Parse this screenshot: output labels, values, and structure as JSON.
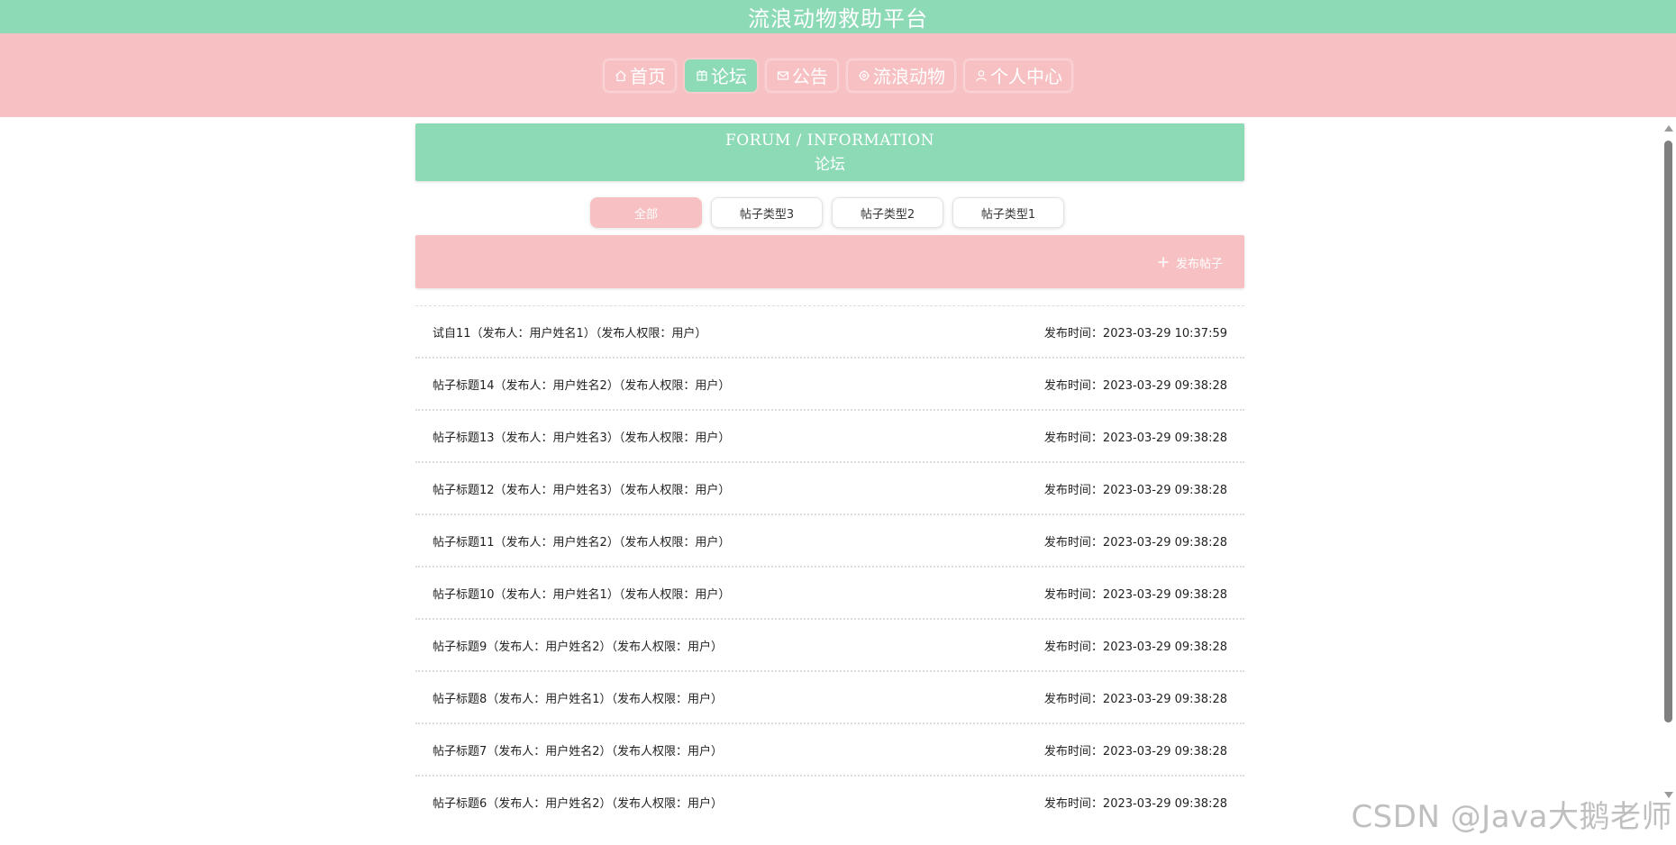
{
  "app": {
    "title": "流浪动物救助平台"
  },
  "nav": {
    "items": [
      {
        "label": "首页",
        "icon": "home-icon",
        "active": false
      },
      {
        "label": "论坛",
        "icon": "forum-icon",
        "active": true
      },
      {
        "label": "公告",
        "icon": "mail-icon",
        "active": false
      },
      {
        "label": "流浪动物",
        "icon": "paw-icon",
        "active": false
      },
      {
        "label": "个人中心",
        "icon": "user-icon",
        "active": false
      }
    ]
  },
  "banner": {
    "english": "FORUM / INFORMATION",
    "chinese": "论坛"
  },
  "tabs": [
    {
      "label": "全部",
      "active": true
    },
    {
      "label": "帖子类型3",
      "active": false
    },
    {
      "label": "帖子类型2",
      "active": false
    },
    {
      "label": "帖子类型1",
      "active": false
    }
  ],
  "actions": {
    "publish_label": "发布帖子"
  },
  "posts": [
    {
      "summary": "试自11（发布人：用户姓名1）（发布人权限：用户）",
      "time": "发布时间：2023-03-29 10:37:59"
    },
    {
      "summary": "帖子标题14（发布人：用户姓名2）（发布人权限：用户）",
      "time": "发布时间：2023-03-29 09:38:28"
    },
    {
      "summary": "帖子标题13（发布人：用户姓名3）（发布人权限：用户）",
      "time": "发布时间：2023-03-29 09:38:28"
    },
    {
      "summary": "帖子标题12（发布人：用户姓名3）（发布人权限：用户）",
      "time": "发布时间：2023-03-29 09:38:28"
    },
    {
      "summary": "帖子标题11（发布人：用户姓名2）（发布人权限：用户）",
      "time": "发布时间：2023-03-29 09:38:28"
    },
    {
      "summary": "帖子标题10（发布人：用户姓名1）（发布人权限：用户）",
      "time": "发布时间：2023-03-29 09:38:28"
    },
    {
      "summary": "帖子标题9（发布人：用户姓名2）（发布人权限：用户）",
      "time": "发布时间：2023-03-29 09:38:28"
    },
    {
      "summary": "帖子标题8（发布人：用户姓名1）（发布人权限：用户）",
      "time": "发布时间：2023-03-29 09:38:28"
    },
    {
      "summary": "帖子标题7（发布人：用户姓名2）（发布人权限：用户）",
      "time": "发布时间：2023-03-29 09:38:28"
    },
    {
      "summary": "帖子标题6（发布人：用户姓名2）（发布人权限：用户）",
      "time": "发布时间：2023-03-29 09:38:28"
    }
  ],
  "watermark": "CSDN @Java大鹅老师",
  "colors": {
    "mint": "#8ddab7",
    "pink": "#f7c1c3"
  }
}
